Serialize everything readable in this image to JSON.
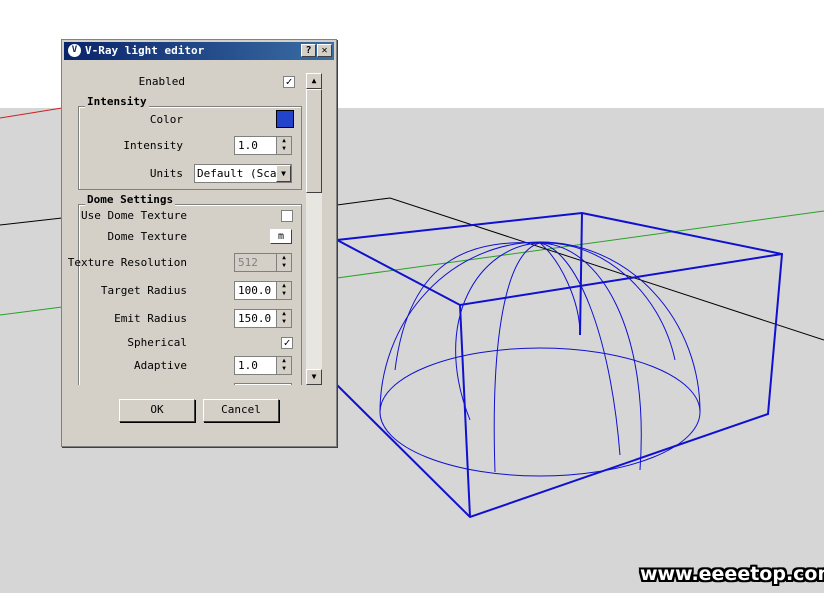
{
  "dialog": {
    "title": "V-Ray light editor",
    "help_label": "?",
    "close_label": "✕",
    "ok_label": "OK",
    "cancel_label": "Cancel"
  },
  "fields": {
    "enabled_label": "Enabled",
    "enabled_checked": "✓",
    "intensity_group": "Intensity",
    "color_label": "Color",
    "color_value": "#2244cc",
    "intensity_label": "Intensity",
    "intensity_value": "1.0",
    "units_label": "Units",
    "units_value": "Default (Scalar)",
    "dome_group": "Dome Settings",
    "use_dome_texture_label": "Use Dome Texture",
    "dome_texture_label": "Dome Texture",
    "dome_texture_button": "m",
    "texture_resolution_label": "Texture Resolution",
    "texture_resolution_value": "512",
    "target_radius_label": "Target Radius",
    "target_radius_value": "100.0",
    "emit_radius_label": "Emit Radius",
    "emit_radius_value": "150.0",
    "spherical_label": "Spherical",
    "spherical_checked": "✓",
    "adaptive_label": "Adaptive",
    "adaptive_value": "1.0"
  },
  "scrollbar": {
    "up_icon": "▲",
    "down_icon": "▼"
  },
  "watermark": "www.eeeetop.com",
  "colors": {
    "wireframe": "#1010d0",
    "axis_green": "#2aa02a",
    "axis_red": "#cc2222"
  }
}
